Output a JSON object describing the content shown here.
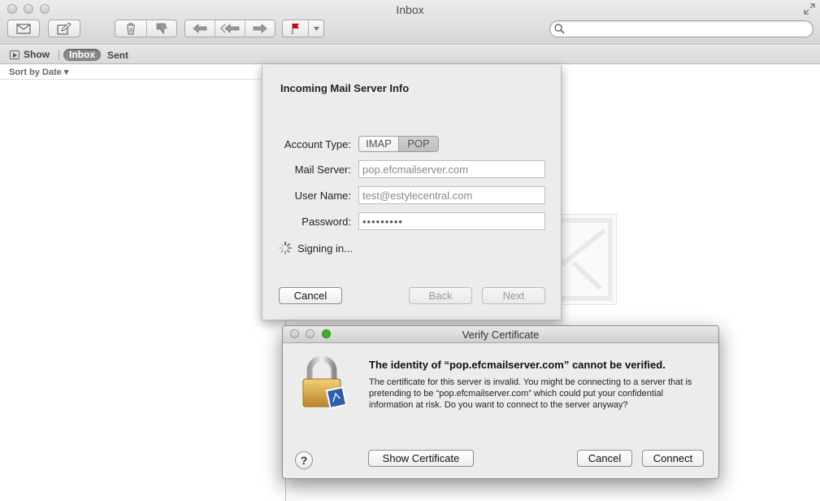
{
  "window": {
    "title": "Inbox"
  },
  "toolbar": {
    "get_mail_icon": "envelope-icon",
    "compose_icon": "compose-icon",
    "delete_icon": "trash-icon",
    "junk_icon": "thumbs-down-icon",
    "reply_icon": "reply-icon",
    "reply_all_icon": "reply-all-icon",
    "forward_icon": "forward-icon",
    "flag_icon": "flag-icon",
    "flag_color": "#d0021b",
    "search_placeholder": ""
  },
  "favorites": {
    "show_label": "Show",
    "inbox_label": "Inbox",
    "sent_label": "Sent"
  },
  "message_list": {
    "sort_label": "Sort by Date ▾"
  },
  "setup_sheet": {
    "title": "Incoming Mail Server Info",
    "account_type_label": "Account Type:",
    "account_types": [
      "IMAP",
      "POP"
    ],
    "account_type_selected": "POP",
    "mail_server_label": "Mail Server:",
    "mail_server_value": "pop.efcmailserver.com",
    "user_name_label": "User Name:",
    "user_name_value": "test@estylecentral.com",
    "password_label": "Password:",
    "password_value": "•••••••••",
    "status_text": "Signing in...",
    "cancel_label": "Cancel",
    "back_label": "Back",
    "next_label": "Next"
  },
  "cert_dialog": {
    "title": "Verify Certificate",
    "heading": "The identity of “pop.efcmailserver.com” cannot be verified.",
    "body": "The certificate for this server is invalid. You might be connecting to a server that is pretending to be “pop.efcmailserver.com” which could put your confidential information at risk. Do you want to connect to the server anyway?",
    "help_label": "?",
    "show_certificate_label": "Show Certificate",
    "cancel_label": "Cancel",
    "connect_label": "Connect",
    "zoom_color": "#3fae2a"
  }
}
